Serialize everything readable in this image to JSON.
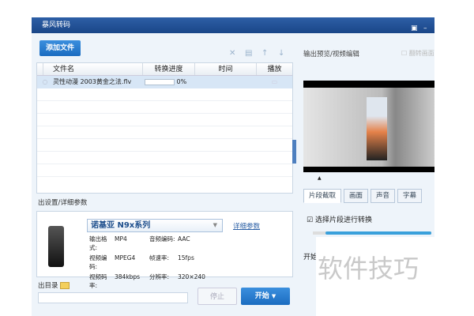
{
  "window": {
    "title": "暴风转码",
    "menu_icon": "dropdown-icon",
    "min_label": "–"
  },
  "toolbar": {
    "add_file": "添加文件",
    "icons": [
      "close-icon",
      "trash-icon",
      "arrow-up-icon",
      "arrow-down-icon"
    ]
  },
  "table": {
    "headers": [
      "文件名",
      "转换进度",
      "时间",
      "播放"
    ],
    "rows": [
      {
        "name": "灵性动漫 2003黄金之法.flv",
        "progress": "0%",
        "progress_value": 0,
        "time": ""
      }
    ]
  },
  "output_settings": {
    "label": "出设置/详细参数",
    "preset": "诺基亚 N9x系列",
    "details_link": "详细参数",
    "params": [
      [
        "输出格式:",
        "MP4",
        "音频编码:",
        "AAC"
      ],
      [
        "视频编码:",
        "MPEG4",
        "帧速率:",
        "15fps"
      ],
      [
        "视频码率:",
        "384kbps",
        "分辨率:",
        "320×240"
      ]
    ]
  },
  "output_dir": {
    "label": "出目录"
  },
  "buttons": {
    "stop": "停止",
    "start": "开始"
  },
  "preview": {
    "label": "输出预览/视频编辑",
    "flip_label": "翻转画面",
    "flip_checked": false,
    "tabs": [
      "片段截取",
      "画面",
      "声音",
      "字幕"
    ],
    "active_tab": 0,
    "segment_label": "选择片段进行转换",
    "segment_checked": true,
    "start_label": "开始"
  },
  "watermark": "软件技巧"
}
